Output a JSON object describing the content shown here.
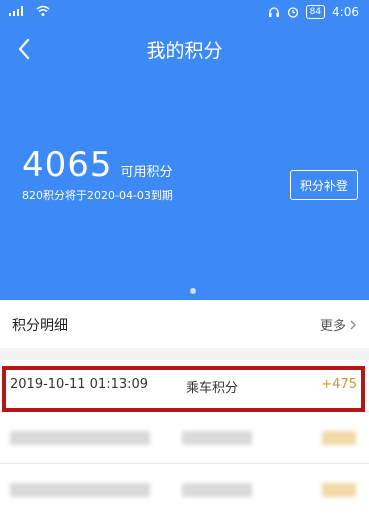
{
  "status_bar": {
    "time": "4:06",
    "battery": "84"
  },
  "nav": {
    "title": "我的积分"
  },
  "summary": {
    "points_value": "4065",
    "points_label": "可用积分",
    "expire_note": "820积分将于2020-04-03到期",
    "supplement_button": "积分补登"
  },
  "detail": {
    "title": "积分明细",
    "more": "更多"
  },
  "records": [
    {
      "time": "2019-10-11 01:13:09",
      "type": "乘车积分",
      "amount": "+475"
    }
  ],
  "colors": {
    "header_blue": "#3d8af7",
    "amount_gold": "#c89a3a",
    "highlight_red": "#b51616"
  }
}
